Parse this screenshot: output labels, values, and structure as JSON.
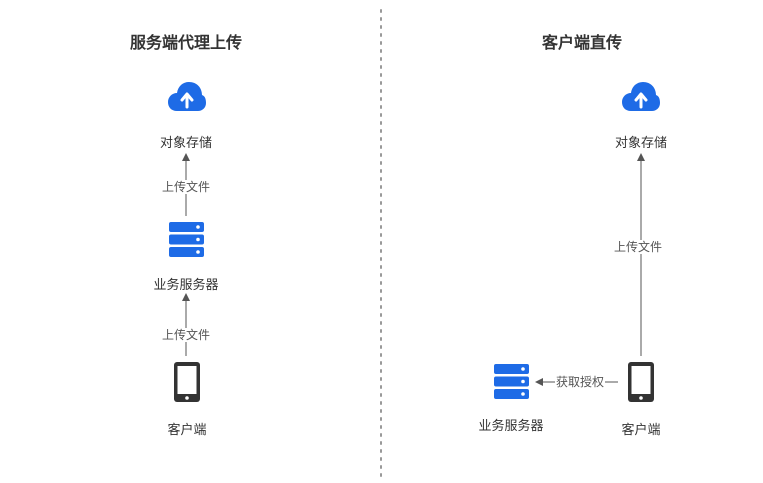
{
  "left": {
    "title": "服务端代理上传",
    "nodes": {
      "storage": {
        "label": "对象存储",
        "icon": "cloud-upload-icon"
      },
      "server": {
        "label": "业务服务器",
        "icon": "server-icon"
      },
      "client": {
        "label": "客户端",
        "icon": "phone-icon"
      }
    },
    "edges": {
      "server_to_storage": "上传文件",
      "client_to_server": "上传文件"
    }
  },
  "right": {
    "title": "客户端直传",
    "nodes": {
      "storage": {
        "label": "对象存储",
        "icon": "cloud-upload-icon"
      },
      "server": {
        "label": "业务服务器",
        "icon": "server-icon"
      },
      "client": {
        "label": "客户端",
        "icon": "phone-icon"
      }
    },
    "edges": {
      "client_to_storage": "上传文件",
      "client_to_server": "获取授权"
    }
  },
  "colors": {
    "accent": "#1e6be6",
    "arrow": "#555555",
    "divider": "#999999",
    "device": "#333333"
  }
}
